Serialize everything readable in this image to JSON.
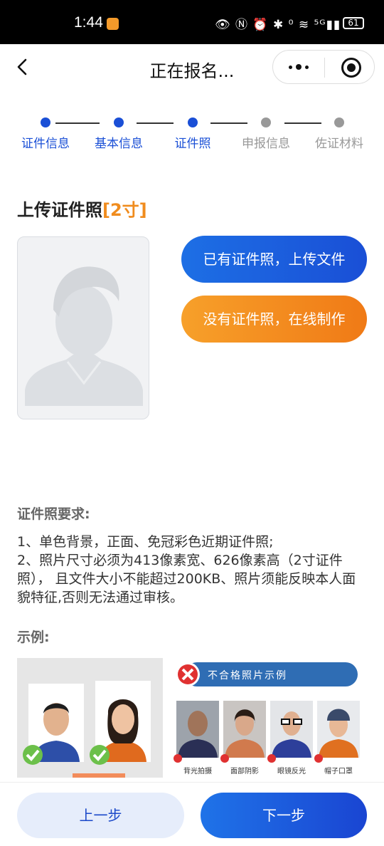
{
  "status": {
    "time": "1:44",
    "icons": "👁 Ⓝ ⏰ ✱ ⁰ ≋ ⁵ᴳ▮▮",
    "speed": "0 K/s",
    "battery": "61"
  },
  "nav": {
    "title": "正在报名..."
  },
  "steps": [
    {
      "label": "证件信息",
      "active": true
    },
    {
      "label": "基本信息",
      "active": true
    },
    {
      "label": "证件照",
      "active": true
    },
    {
      "label": "申报信息",
      "active": false
    },
    {
      "label": "佐证材料",
      "active": false
    }
  ],
  "colors": {
    "active": "#1a4fd6",
    "inactive": "#999999",
    "orange": "#f08c1e"
  },
  "upload": {
    "title": "上传证件照",
    "size_tag": "[2寸]",
    "btn_upload": "已有证件照，上传文件",
    "btn_make": "没有证件照，在线制作"
  },
  "requirements": {
    "title": "证件照要求:",
    "line1": "1、单色背景，正面、免冠彩色近期证件照;",
    "line2": "2、照片尺寸必须为413像素宽、626像素高（2寸证件照）， 且文件大小不能超过200KB、照片须能反映本人面貌特征,否则无法通过审核。"
  },
  "example": {
    "title": "示例:",
    "bad_banner": "不合格照片示例",
    "bad_labels": [
      "背光拍摄",
      "面部阴影",
      "眼镜反光",
      "帽子口罩"
    ]
  },
  "bottom": {
    "prev": "上一步",
    "next": "下一步"
  }
}
